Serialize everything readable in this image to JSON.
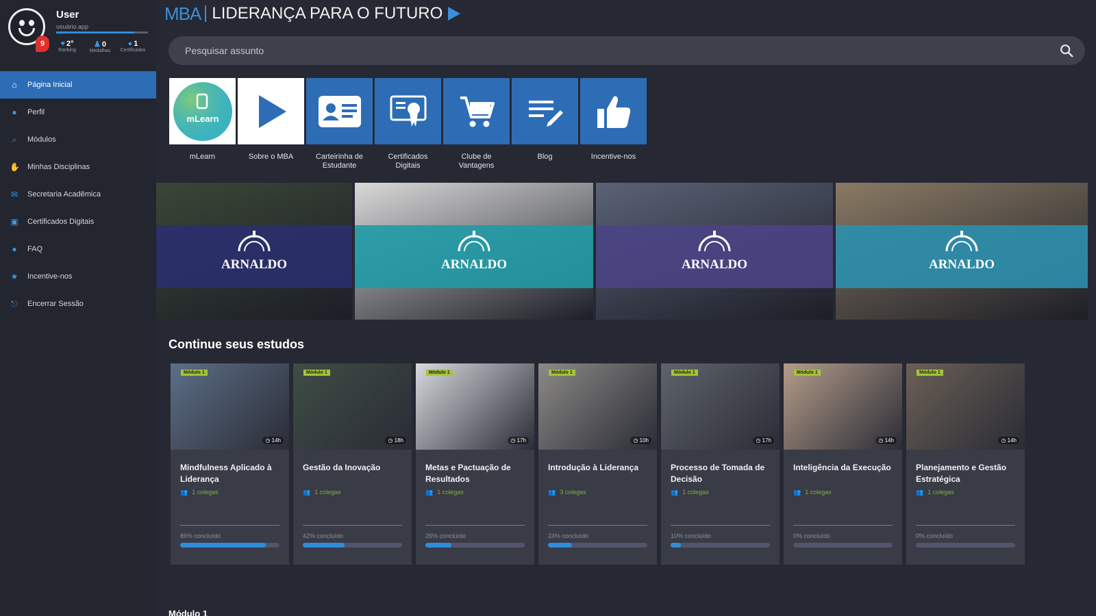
{
  "user": {
    "name": "User",
    "subtitle": "usuário.app",
    "notifications": "9",
    "progress": 0.85,
    "stats": [
      {
        "value": "2°",
        "label": "Ranking",
        "icon": "trophy-icon"
      },
      {
        "value": "0",
        "label": "Medalhas",
        "icon": "medal-icon"
      },
      {
        "value": "1",
        "label": "Certificados",
        "icon": "certificate-icon"
      }
    ]
  },
  "nav": [
    {
      "label": "Página Inicial",
      "icon": "home-icon",
      "active": true
    },
    {
      "label": "Perfil",
      "icon": "person-icon"
    },
    {
      "label": "Módulos",
      "icon": "search-icon"
    },
    {
      "label": "Minhas Disciplinas",
      "icon": "hand-icon"
    },
    {
      "label": "Secretaria Acadêmica",
      "icon": "mail-icon"
    },
    {
      "label": "Certificados Digitais",
      "icon": "certificate-icon"
    },
    {
      "label": "FAQ",
      "icon": "info-icon"
    },
    {
      "label": "Incentive-nos",
      "icon": "star-icon"
    },
    {
      "label": "Encerrar Sessão",
      "icon": "logout-icon"
    }
  ],
  "header": {
    "brand_short": "MBA",
    "brand_title": "LIDERANÇA PARA O FUTURO"
  },
  "search": {
    "placeholder": "Pesquisar assunto"
  },
  "quick_links": [
    {
      "label": "mLearn",
      "icon": "mlearn-logo-icon",
      "tile_text": "mLearn"
    },
    {
      "label": "Sobre o MBA",
      "icon": "play-icon"
    },
    {
      "label": "Carteirinha de Estudante",
      "icon": "id-card-icon"
    },
    {
      "label": "Certificados Digitais",
      "icon": "certificate-icon"
    },
    {
      "label": "Clube de Vantagens",
      "icon": "cart-icon"
    },
    {
      "label": "Blog",
      "icon": "blog-icon"
    },
    {
      "label": "Incentive-nos",
      "icon": "thumbs-up-icon"
    }
  ],
  "banners": [
    {
      "logo": "ARNALDO",
      "colors": {
        "bg": "#3a4636",
        "band": "#2a2f6e"
      }
    },
    {
      "logo": "ARNALDO",
      "colors": {
        "bg": "#d9d9d9",
        "band": "#1f9aa6"
      }
    },
    {
      "logo": "ARNALDO",
      "colors": {
        "bg": "#5b6277",
        "band": "#4a4485"
      }
    },
    {
      "logo": "ARNALDO",
      "colors": {
        "bg": "#8a7a64",
        "band": "#2b8fae"
      }
    }
  ],
  "continue": {
    "title": "Continue seus estudos",
    "courses": [
      {
        "title": "Mindfulness Aplicado à Liderança",
        "colleagues": "1 colegas",
        "progress_label": "86% concluído",
        "progress": 0.86,
        "badge": "Módulo 1",
        "duration": "14h",
        "img": "#5d6f86"
      },
      {
        "title": "Gestão da Inovação",
        "colleagues": "1 colegas",
        "progress_label": "42% concluído",
        "progress": 0.42,
        "badge": "Módulo 1",
        "duration": "18h",
        "img": "#3f4d44"
      },
      {
        "title": "Metas e Pactuação de Resultados",
        "colleagues": "1 colegas",
        "progress_label": "26% concluído",
        "progress": 0.26,
        "badge": "Módulo 1",
        "duration": "17h",
        "img": "#d6d9dd"
      },
      {
        "title": "Introdução à Liderança",
        "colleagues": "3 colegas",
        "progress_label": "24% concluído",
        "progress": 0.24,
        "badge": "Módulo 1",
        "duration": "10h",
        "img": "#8c8a86"
      },
      {
        "title": "Processo de Tomada de Decisão",
        "colleagues": "1 colegas",
        "progress_label": "10% concluído",
        "progress": 0.1,
        "badge": "Módulo 1",
        "duration": "17h",
        "img": "#5f636b"
      },
      {
        "title": "Inteligência da Execução",
        "colleagues": "1 colegas",
        "progress_label": "0% concluído",
        "progress": 0.0,
        "badge": "Módulo 1",
        "duration": "14h",
        "img": "#b49c8a"
      },
      {
        "title": "Planejamento e Gestão Estratégica",
        "colleagues": "1 colegas",
        "progress_label": "0% concluído",
        "progress": 0.0,
        "badge": "Módulo 1",
        "duration": "14h",
        "img": "#6b6055"
      }
    ]
  },
  "module_section": {
    "title": "Módulo 1"
  },
  "colors": {
    "accent": "#2d6db5",
    "background": "#262833",
    "card": "#393b46",
    "progress": "#2e8ddb",
    "colleagues": "#7fb23a"
  }
}
